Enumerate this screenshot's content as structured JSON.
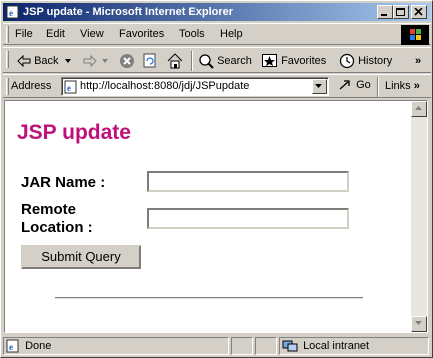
{
  "window": {
    "title": "JSP update - Microsoft Internet Explorer"
  },
  "menu": {
    "items": [
      {
        "label": "File"
      },
      {
        "label": "Edit"
      },
      {
        "label": "View"
      },
      {
        "label": "Favorites"
      },
      {
        "label": "Tools"
      },
      {
        "label": "Help"
      }
    ]
  },
  "toolbar": {
    "back_label": "Back",
    "search_label": "Search",
    "favorites_label": "Favorites",
    "history_label": "History"
  },
  "address": {
    "label": "Address",
    "url": "http://localhost:8080/jdj/JSPupdate",
    "go_label": "Go",
    "links_label": "Links"
  },
  "page": {
    "heading": "JSP update",
    "jar_name_label": "JAR Name :",
    "jar_name_value": "",
    "remote_label_line1": "Remote",
    "remote_label_line2": "Location :",
    "remote_value": "",
    "submit_label": "Submit Query"
  },
  "status": {
    "text": "Done",
    "zone": "Local intranet"
  },
  "colors": {
    "heading": "#c0107a",
    "titlebar_start": "#0a246a",
    "titlebar_end": "#a6caf0"
  }
}
